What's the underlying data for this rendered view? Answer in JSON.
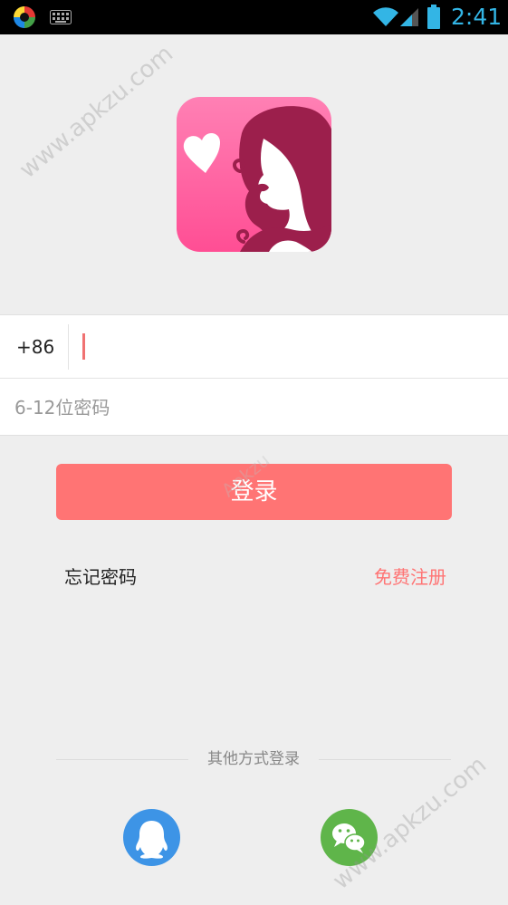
{
  "status_bar": {
    "time": "2:41",
    "icons": [
      "app-icon",
      "keyboard-icon",
      "wifi-icon",
      "signal-icon",
      "battery-icon"
    ],
    "time_color": "#33B5E5"
  },
  "logo": {
    "icon": "app-logo-icon",
    "gradient_top": "#FF80B4",
    "gradient_bottom": "#FF4E94",
    "figure_color": "#9C1F4C"
  },
  "form": {
    "country_code": "+86",
    "phone_value": "",
    "password_placeholder": "6-12位密码"
  },
  "login_button": {
    "label": "登录",
    "color": "#FF7474"
  },
  "links": {
    "forgot_password": "忘记密码",
    "register": "免费注册"
  },
  "other_login": {
    "label": "其他方式登录",
    "qq_icon": "qq-icon",
    "wechat_icon": "wechat-icon",
    "qq_color": "#3D94E6",
    "wechat_color": "#5FB54A"
  },
  "watermarks": {
    "top": "www.apkzu.com",
    "middle": "Apkzu",
    "bottom": "www.apkzu.com"
  }
}
